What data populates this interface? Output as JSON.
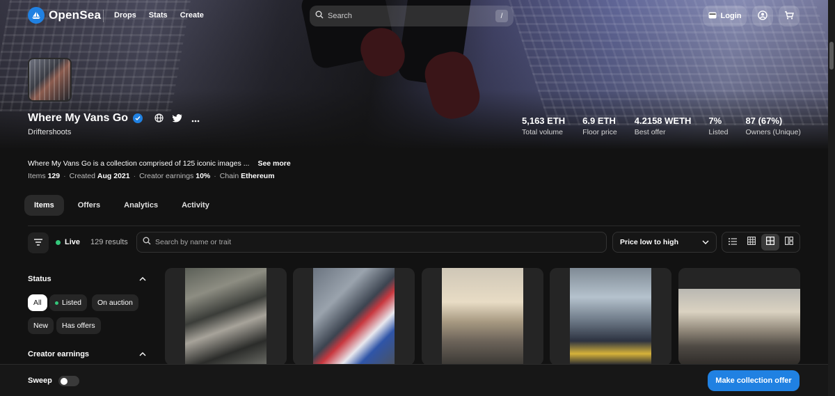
{
  "nav": {
    "brand": "OpenSea",
    "links": [
      "Drops",
      "Stats",
      "Create"
    ],
    "search_placeholder": "Search",
    "search_shortcut": "/",
    "login_label": "Login"
  },
  "collection": {
    "name": "Where My Vans Go",
    "creator": "Driftershoots",
    "description": "Where My Vans Go is a collection comprised of 125 iconic images ...",
    "see_more": "See more",
    "meta": {
      "items_label": "Items",
      "items_value": "129",
      "created_label": "Created",
      "created_value": "Aug 2021",
      "earnings_label": "Creator earnings",
      "earnings_value": "10%",
      "chain_label": "Chain",
      "chain_value": "Ethereum"
    }
  },
  "stats": [
    {
      "value": "5,163 ETH",
      "label": "Total volume"
    },
    {
      "value": "6.9 ETH",
      "label": "Floor price"
    },
    {
      "value": "4.2158 WETH",
      "label": "Best offer"
    },
    {
      "value": "7%",
      "label": "Listed"
    },
    {
      "value": "87 (67%)",
      "label": "Owners (Unique)"
    }
  ],
  "tabs": [
    "Items",
    "Offers",
    "Analytics",
    "Activity"
  ],
  "toolbar": {
    "live_label": "Live",
    "results": "129 results",
    "search_placeholder": "Search by name or trait",
    "sort_label": "Price low to high"
  },
  "sidebar": {
    "status_heading": "Status",
    "status_chips": [
      "All",
      "Listed",
      "On auction",
      "New",
      "Has offers"
    ],
    "earnings_heading": "Creator earnings"
  },
  "bottom": {
    "sweep_label": "Sweep",
    "offer_label": "Make collection offer"
  },
  "colors": {
    "accent": "#2081e2",
    "live": "#34c77b",
    "background": "#121212"
  }
}
